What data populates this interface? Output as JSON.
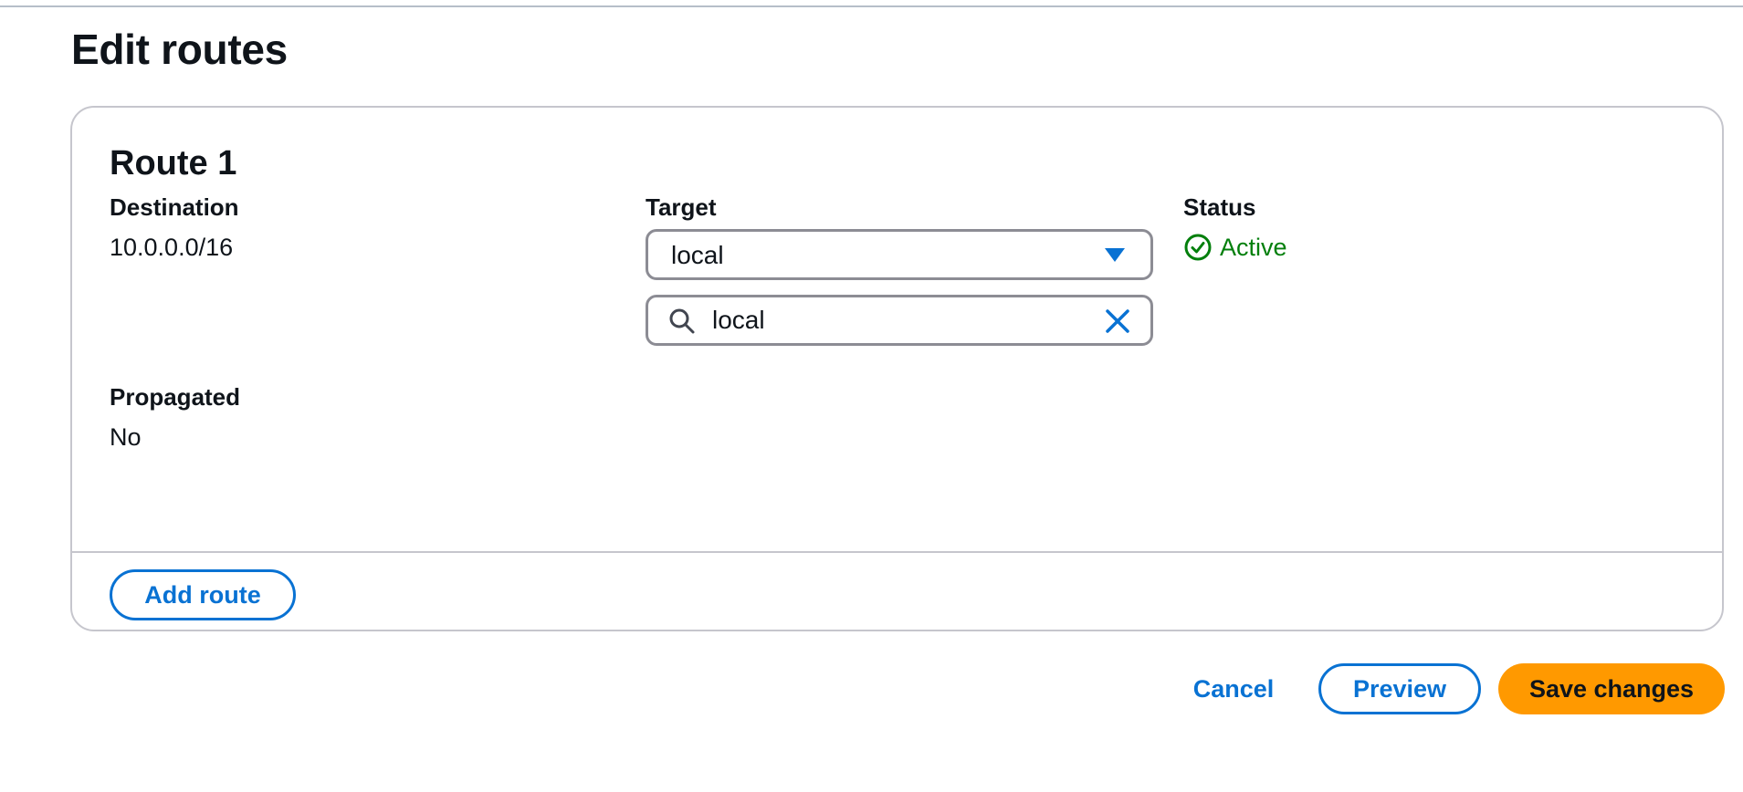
{
  "page": {
    "title": "Edit routes"
  },
  "route": {
    "heading": "Route 1",
    "destination_label": "Destination",
    "destination_value": "10.0.0.0/16",
    "target_label": "Target",
    "target_selected": "local",
    "target_search_value": "local",
    "status_label": "Status",
    "status_value": "Active",
    "propagated_label": "Propagated",
    "propagated_value": "No"
  },
  "buttons": {
    "add_route": "Add route",
    "cancel": "Cancel",
    "preview": "Preview",
    "save": "Save changes"
  },
  "colors": {
    "accent": "#0972d3",
    "success": "#037f0c",
    "primary_button": "#ff9900",
    "border": "#8c8c94"
  },
  "icons": {
    "dropdown": "caret-down-icon",
    "search": "search-icon",
    "clear": "close-icon",
    "status": "check-circle-icon"
  }
}
